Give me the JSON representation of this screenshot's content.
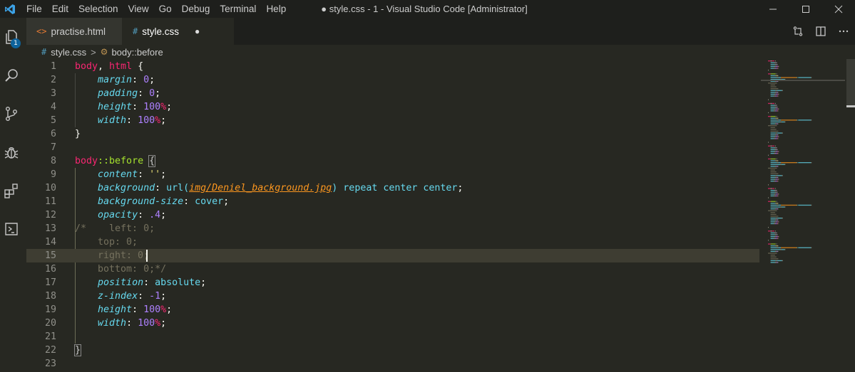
{
  "window": {
    "title": "● style.css - 1 - Visual Studio Code [Administrator]",
    "controls": [
      "minimize",
      "maximize",
      "close"
    ]
  },
  "menu": [
    "File",
    "Edit",
    "Selection",
    "View",
    "Go",
    "Debug",
    "Terminal",
    "Help"
  ],
  "activity_bar": {
    "items": [
      "files-icon",
      "search-icon",
      "source-control-icon",
      "debug-icon",
      "extensions-icon",
      "terminal-icon"
    ],
    "explorer_badge": "1"
  },
  "tabs": [
    {
      "label": "practise.html",
      "icon": "<>",
      "active": false
    },
    {
      "label": "style.css",
      "icon": "#",
      "active": true,
      "dirty_marker": "●"
    }
  ],
  "breadcrumb": {
    "file_icon": "#",
    "file": "style.css",
    "separator": ">",
    "symbol": "body::before"
  },
  "editor": {
    "line_numbers": [
      "1",
      "2",
      "3",
      "4",
      "5",
      "6",
      "7",
      "8",
      "9",
      "10",
      "11",
      "12",
      "13",
      "14",
      "15",
      "16",
      "17",
      "18",
      "19",
      "20",
      "21",
      "22",
      "23"
    ],
    "current_line": 15,
    "lines": [
      [
        {
          "t": "body",
          "c": "kw"
        },
        {
          "t": ", ",
          "c": "pu"
        },
        {
          "t": "html",
          "c": "kw"
        },
        {
          "t": " {",
          "c": "pu"
        }
      ],
      [
        {
          "t": "    "
        },
        {
          "t": "margin",
          "c": "pr"
        },
        {
          "t": ": ",
          "c": "pu"
        },
        {
          "t": "0",
          "c": "nu"
        },
        {
          "t": ";",
          "c": "pu"
        }
      ],
      [
        {
          "t": "    "
        },
        {
          "t": "padding",
          "c": "pr"
        },
        {
          "t": ": ",
          "c": "pu"
        },
        {
          "t": "0",
          "c": "nu"
        },
        {
          "t": ";",
          "c": "pu"
        }
      ],
      [
        {
          "t": "    "
        },
        {
          "t": "height",
          "c": "pr"
        },
        {
          "t": ": ",
          "c": "pu"
        },
        {
          "t": "100",
          "c": "nu"
        },
        {
          "t": "%",
          "c": "un"
        },
        {
          "t": ";",
          "c": "pu"
        }
      ],
      [
        {
          "t": "    "
        },
        {
          "t": "width",
          "c": "pr"
        },
        {
          "t": ": ",
          "c": "pu"
        },
        {
          "t": "100",
          "c": "nu"
        },
        {
          "t": "%",
          "c": "un"
        },
        {
          "t": ";",
          "c": "pu"
        }
      ],
      [
        {
          "t": "}",
          "c": "pu"
        }
      ],
      [],
      [
        {
          "t": "body",
          "c": "kw"
        },
        {
          "t": "::before",
          "c": "pp"
        },
        {
          "t": " ",
          "c": "pu"
        },
        {
          "t": "{",
          "c": "brm"
        }
      ],
      [
        {
          "t": "    "
        },
        {
          "t": "content",
          "c": "pr"
        },
        {
          "t": ": ",
          "c": "pu"
        },
        {
          "t": "''",
          "c": "st"
        },
        {
          "t": ";",
          "c": "pu"
        }
      ],
      [
        {
          "t": "    "
        },
        {
          "t": "background",
          "c": "pr"
        },
        {
          "t": ": ",
          "c": "pu"
        },
        {
          "t": "url(",
          "c": "vl"
        },
        {
          "t": "img/Deniel_background.jpg",
          "c": "ur"
        },
        {
          "t": ")",
          "c": "vl"
        },
        {
          "t": " repeat center center",
          "c": "vl"
        },
        {
          "t": ";",
          "c": "pu"
        }
      ],
      [
        {
          "t": "    "
        },
        {
          "t": "background-size",
          "c": "pr"
        },
        {
          "t": ": ",
          "c": "pu"
        },
        {
          "t": "cover",
          "c": "vl"
        },
        {
          "t": ";",
          "c": "pu"
        }
      ],
      [
        {
          "t": "    "
        },
        {
          "t": "opacity",
          "c": "pr"
        },
        {
          "t": ": ",
          "c": "pu"
        },
        {
          "t": ".4",
          "c": "nu"
        },
        {
          "t": ";",
          "c": "pu"
        }
      ],
      [
        {
          "t": "/*    left: 0;",
          "c": "cm"
        }
      ],
      [
        {
          "t": "    top: 0;",
          "c": "cm"
        }
      ],
      [
        {
          "t": "    right: 0;",
          "c": "cm"
        }
      ],
      [
        {
          "t": "    bottom: 0;*/",
          "c": "cm"
        }
      ],
      [
        {
          "t": "    "
        },
        {
          "t": "position",
          "c": "pr"
        },
        {
          "t": ": ",
          "c": "pu"
        },
        {
          "t": "absolute",
          "c": "vl"
        },
        {
          "t": ";",
          "c": "pu"
        }
      ],
      [
        {
          "t": "    "
        },
        {
          "t": "z-index",
          "c": "pr"
        },
        {
          "t": ": ",
          "c": "pu"
        },
        {
          "t": "-1",
          "c": "nu"
        },
        {
          "t": ";",
          "c": "pu"
        }
      ],
      [
        {
          "t": "    "
        },
        {
          "t": "height",
          "c": "pr"
        },
        {
          "t": ": ",
          "c": "pu"
        },
        {
          "t": "100",
          "c": "nu"
        },
        {
          "t": "%",
          "c": "un"
        },
        {
          "t": ";",
          "c": "pu"
        }
      ],
      [
        {
          "t": "    "
        },
        {
          "t": "width",
          "c": "pr"
        },
        {
          "t": ": ",
          "c": "pu"
        },
        {
          "t": "100",
          "c": "nu"
        },
        {
          "t": "%",
          "c": "un"
        },
        {
          "t": ";",
          "c": "pu"
        }
      ],
      [],
      [
        {
          "t": "}",
          "c": "brm"
        }
      ],
      []
    ]
  },
  "colors": {
    "editor_bg": "#272822",
    "titlebar_bg": "#1e1f1c",
    "current_line_bg": "#3e3d32",
    "keyword": "#f92672",
    "property": "#66d9ef",
    "number": "#ae81ff",
    "string": "#e6db74",
    "comment": "#75715e",
    "accent_blue": "#0e639c"
  }
}
